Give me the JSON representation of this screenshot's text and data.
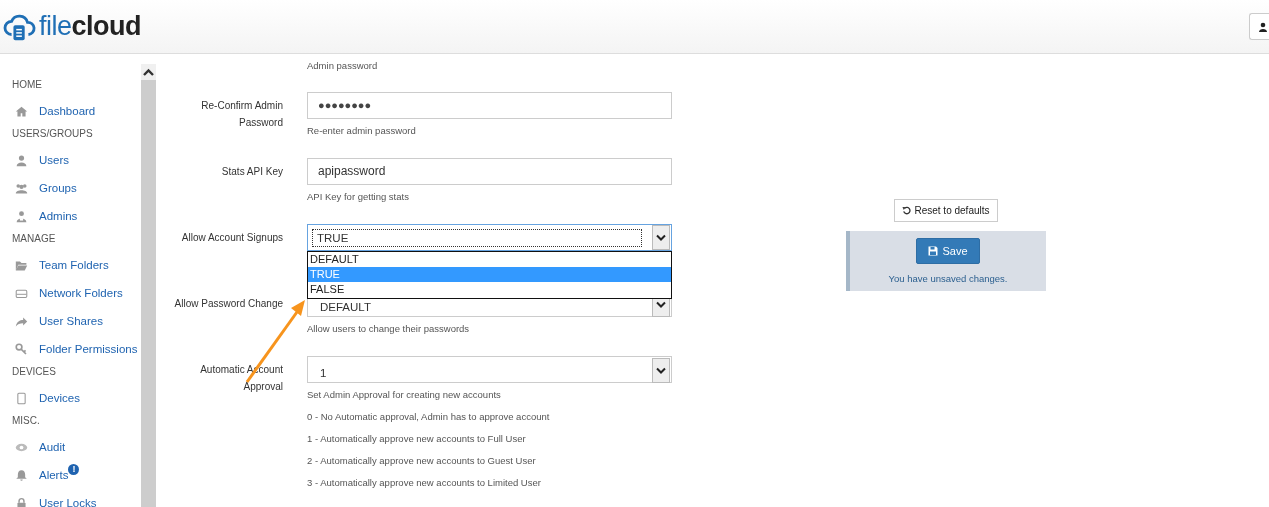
{
  "header": {
    "logo_part_1": "file",
    "logo_part_2": "cloud"
  },
  "sidebar": {
    "items": [
      {
        "kind": "heading",
        "label": "HOME"
      },
      {
        "kind": "link",
        "label": "Dashboard"
      },
      {
        "kind": "heading",
        "label": "USERS/GROUPS"
      },
      {
        "kind": "link",
        "label": "Users"
      },
      {
        "kind": "link",
        "label": "Groups"
      },
      {
        "kind": "link",
        "label": "Admins"
      },
      {
        "kind": "heading",
        "label": "MANAGE"
      },
      {
        "kind": "link",
        "label": "Team Folders"
      },
      {
        "kind": "link",
        "label": "Network Folders"
      },
      {
        "kind": "link",
        "label": "User Shares"
      },
      {
        "kind": "link",
        "label": "Folder Permissions"
      },
      {
        "kind": "heading",
        "label": "DEVICES"
      },
      {
        "kind": "link",
        "label": "Devices"
      },
      {
        "kind": "heading",
        "label": "MISC."
      },
      {
        "kind": "link",
        "label": "Audit"
      },
      {
        "kind": "link",
        "label": "Alerts",
        "badge": "!"
      },
      {
        "kind": "link",
        "label": "User Locks"
      }
    ]
  },
  "top_hint": "Admin password",
  "fields": [
    {
      "kind": "password",
      "label": "Re-Confirm Admin Password",
      "value": "●●●●●●●●",
      "hint": "Re-enter admin password"
    },
    {
      "kind": "text",
      "label": "Stats API Key",
      "value": "apipassword",
      "hint": "API Key for getting stats"
    },
    {
      "kind": "select",
      "label": "Allow Account Signups",
      "value": "TRUE",
      "focused": true,
      "open": true,
      "options": [
        {
          "label": "DEFAULT",
          "selected": false
        },
        {
          "label": "TRUE",
          "selected": true
        },
        {
          "label": "FALSE",
          "selected": false
        }
      ]
    },
    {
      "kind": "select",
      "label": "Allow Password Change",
      "value": "DEFAULT",
      "hint": "Allow users to change their passwords"
    },
    {
      "kind": "select",
      "label": "Automatic Account Approval",
      "value": "1",
      "hint": "Set Admin Approval for creating new accounts",
      "notes": [
        "0 - No Automatic approval, Admin has to approve account",
        "1 - Automatically approve new accounts to Full User",
        "2 - Automatically approve new accounts to Guest User",
        "3 - Automatically approve new accounts to Limited User"
      ]
    }
  ],
  "actions": {
    "reset": "Reset to defaults",
    "save": "Save",
    "status": "You have unsaved changes."
  }
}
